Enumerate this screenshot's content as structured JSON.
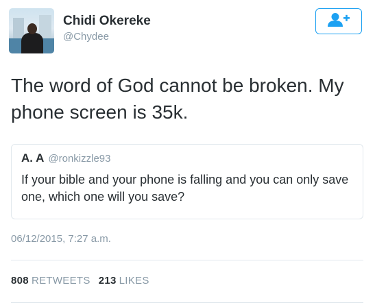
{
  "tweet": {
    "author_name": "Chidi Okereke",
    "author_handle": "@Chydee",
    "text": "The word of God cannot be broken. My phone screen is 35k.",
    "timestamp": "06/12/2015, 7:27 a.m."
  },
  "quoted_tweet": {
    "author_name": "A. A",
    "author_handle": "@ronkizzle93",
    "text": "If your bible and your phone is falling and you can only save one, which one will you save?"
  },
  "stats": {
    "retweets_count": "808",
    "retweets_label": "RETWEETS",
    "likes_count": "213",
    "likes_label": "LIKES"
  },
  "follow_button": {
    "icon": "add-user-icon"
  },
  "colors": {
    "accent": "#1da1f2",
    "text": "#292f33",
    "muted": "#8899a6",
    "border": "#e1e8ed"
  }
}
